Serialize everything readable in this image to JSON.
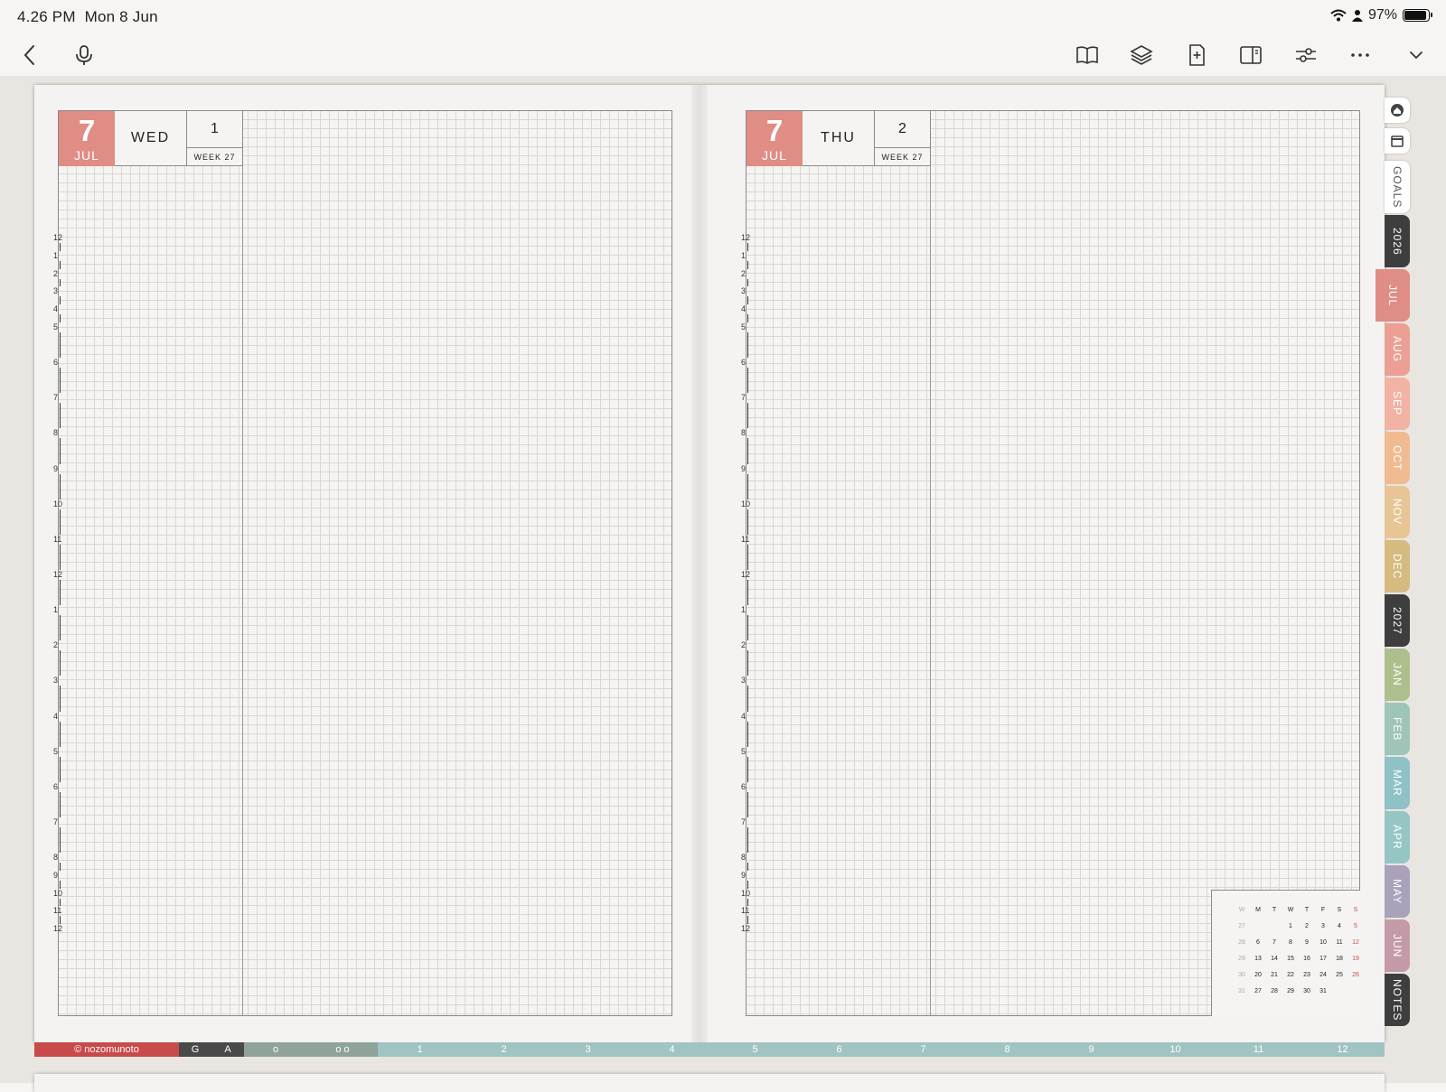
{
  "status": {
    "time": "4.26 PM",
    "date": "Mon 8 Jun",
    "battery": "97%",
    "battery_level": 0.97
  },
  "toolbar": {
    "left": [
      {
        "name": "back-chevron-icon"
      },
      {
        "name": "microphone-icon"
      }
    ],
    "right": [
      {
        "name": "book-view-icon"
      },
      {
        "name": "layers-icon"
      },
      {
        "name": "add-page-icon"
      },
      {
        "name": "sidebar-panel-icon"
      },
      {
        "name": "sliders-icon"
      },
      {
        "name": "more-icon"
      },
      {
        "name": "chevron-down-icon"
      }
    ]
  },
  "left_page": {
    "date_num": "7",
    "month": "JUL",
    "weekday": "WED",
    "day": "1",
    "week": "WEEK 27"
  },
  "right_page": {
    "date_num": "7",
    "month": "JUL",
    "weekday": "THU",
    "day": "2",
    "week": "WEEK 27"
  },
  "hour_labels": [
    "12",
    "1",
    "2",
    "3",
    "4",
    "5",
    "6",
    "7",
    "8",
    "9",
    "10",
    "11",
    "12",
    "1",
    "2",
    "3",
    "4",
    "5",
    "6",
    "7",
    "8",
    "9",
    "10",
    "11",
    "12"
  ],
  "mini_calendar": {
    "headers": [
      "W",
      "M",
      "T",
      "W",
      "T",
      "F",
      "S",
      "S"
    ],
    "rows": [
      [
        "27",
        "",
        "",
        "1",
        "2",
        "3",
        "4",
        "5"
      ],
      [
        "28",
        "6",
        "7",
        "8",
        "9",
        "10",
        "11",
        "12"
      ],
      [
        "29",
        "13",
        "14",
        "15",
        "16",
        "17",
        "18",
        "19"
      ],
      [
        "30",
        "20",
        "21",
        "22",
        "23",
        "24",
        "25",
        "26"
      ],
      [
        "31",
        "27",
        "28",
        "29",
        "30",
        "31",
        "",
        ""
      ]
    ]
  },
  "side_tabs": [
    {
      "label": "GOALS",
      "color": "#ffffff",
      "text_color": "#555555"
    },
    {
      "label": "2026",
      "color": "#3e3e3e",
      "text_color": "#ffffff"
    },
    {
      "label": "JUL",
      "color": "#df8d85",
      "text_color": "#ffffff",
      "active": true
    },
    {
      "label": "AUG",
      "color": "#ec9f94",
      "text_color": "#ffffff"
    },
    {
      "label": "SEP",
      "color": "#f2b3a4",
      "text_color": "#ffffff"
    },
    {
      "label": "OCT",
      "color": "#f0bb90",
      "text_color": "#ffffff"
    },
    {
      "label": "NOV",
      "color": "#e7c595",
      "text_color": "#ffffff"
    },
    {
      "label": "DEC",
      "color": "#d6bb80",
      "text_color": "#ffffff"
    },
    {
      "label": "2027",
      "color": "#3e3e3e",
      "text_color": "#ffffff"
    },
    {
      "label": "JAN",
      "color": "#aebf8e",
      "text_color": "#ffffff"
    },
    {
      "label": "FEB",
      "color": "#9fc4b8",
      "text_color": "#ffffff"
    },
    {
      "label": "MAR",
      "color": "#8fc2c6",
      "text_color": "#ffffff"
    },
    {
      "label": "APR",
      "color": "#96c6c4",
      "text_color": "#ffffff"
    },
    {
      "label": "MAY",
      "color": "#aaa1bb",
      "text_color": "#ffffff"
    },
    {
      "label": "JUN",
      "color": "#c59aa8",
      "text_color": "#ffffff"
    },
    {
      "label": "NOTES",
      "color": "#3e3e3e",
      "text_color": "#ffffff"
    }
  ],
  "bottom_strip": {
    "brand": "© nozomunoto",
    "brand_color": "#c94a4a",
    "letters": [
      "G",
      "A"
    ],
    "letters_color": "#4a4a4a",
    "dots": [
      "o",
      "o o"
    ],
    "dots_color": "#8fa39a",
    "months": [
      "1",
      "2",
      "3",
      "4",
      "5",
      "6",
      "7",
      "8",
      "9",
      "10",
      "11",
      "12"
    ],
    "months_color": "#9fc4c2"
  }
}
